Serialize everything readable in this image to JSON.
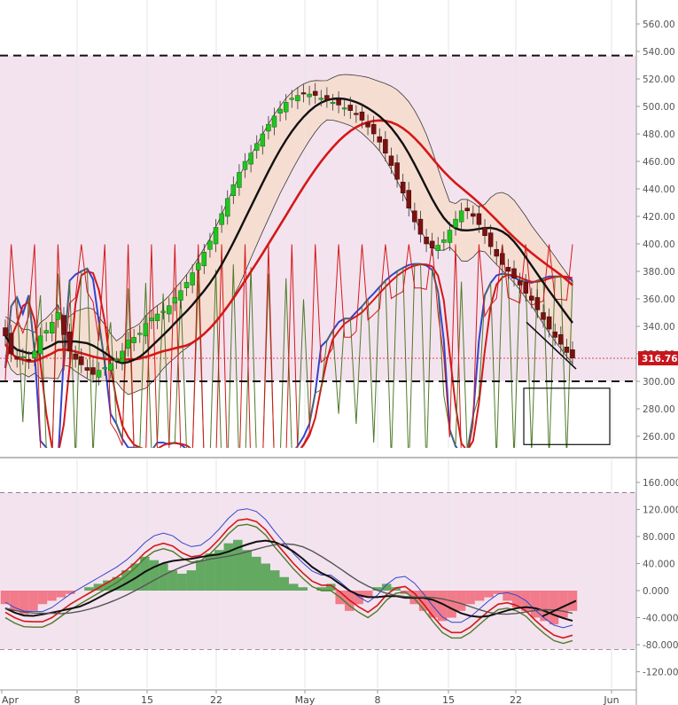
{
  "colors": {
    "band_fill": "#f6dccd",
    "pink_zone": "#f3e3ef",
    "green_candle": "#22c322",
    "red_candle": "#7a1212",
    "price_label_bg": "#c8161d",
    "blue_line": "#3344cc",
    "red_line": "#d41818",
    "olive_line": "#4f7a28",
    "black_line": "#111111",
    "hist_pos": "#3f9a3f",
    "hist_neg": "#f06070"
  },
  "top_panel": {
    "y_axis_ticks": [
      "560.00",
      "540.00",
      "520.00",
      "500.00",
      "480.00",
      "460.00",
      "440.00",
      "420.00",
      "400.00",
      "380.00",
      "360.00",
      "340.00",
      "320.00",
      "300.00",
      "280.00",
      "260.00"
    ],
    "last_price_label": "316.76"
  },
  "bottom_panel": {
    "y_axis_ticks": [
      "160.000",
      "120.000",
      "80.000",
      "40.000",
      "0.000",
      "-40.000",
      "-80.000",
      "-120.000"
    ]
  },
  "x_axis": {
    "labels": [
      "Apr",
      "8",
      "15",
      "22",
      "May",
      "8",
      "15",
      "22",
      "Jun"
    ]
  },
  "chart_data": [
    {
      "type": "candlestick",
      "y_axis_ticks": [
        560,
        540,
        520,
        500,
        480,
        460,
        440,
        420,
        400,
        380,
        360,
        340,
        320,
        300,
        280,
        260
      ],
      "ylim": [
        251,
        571
      ],
      "x_labels": [
        "Apr",
        "8",
        "15",
        "22",
        "May",
        "8",
        "15",
        "22",
        "Jun"
      ],
      "last_price": 316.76,
      "horizontal_levels": [
        537,
        300
      ],
      "series": [
        {
          "name": "close",
          "values": [
            333,
            320,
            316,
            318,
            315,
            322,
            333,
            337,
            343,
            350,
            334,
            322,
            316,
            312,
            308,
            305,
            308,
            310,
            313,
            316,
            322,
            330,
            332,
            335,
            342,
            346,
            349,
            351,
            355,
            361,
            366,
            372,
            379,
            386,
            394,
            402,
            412,
            422,
            433,
            443,
            452,
            460,
            466,
            473,
            480,
            487,
            493,
            498,
            503,
            506,
            508,
            509,
            509,
            508,
            506,
            505,
            503,
            501,
            499,
            497,
            494,
            490,
            485,
            480,
            474,
            466,
            457,
            447,
            437,
            426,
            416,
            407,
            400,
            397,
            399,
            403,
            410,
            418,
            424,
            424,
            420,
            414,
            406,
            398,
            391,
            385,
            380,
            375,
            370,
            364,
            359,
            352,
            345,
            338,
            332,
            327,
            321,
            317
          ]
        }
      ]
    },
    {
      "type": "line",
      "y_axis_ticks": [
        160,
        120,
        80,
        40,
        0,
        -40,
        -80,
        -120
      ],
      "ylim": [
        -130,
        180
      ],
      "x_labels": [
        "Apr",
        "8",
        "15",
        "22",
        "May",
        "8",
        "15",
        "22",
        "Jun"
      ],
      "horizontal_levels": [
        145,
        -87
      ],
      "series": [
        {
          "name": "histogram",
          "values": [
            -20,
            -30,
            -35,
            -30,
            -20,
            -15,
            -10,
            -5,
            0,
            5,
            10,
            15,
            20,
            30,
            40,
            50,
            45,
            40,
            30,
            25,
            30,
            45,
            55,
            60,
            70,
            75,
            60,
            50,
            40,
            30,
            20,
            10,
            5,
            0,
            5,
            10,
            -20,
            -30,
            -20,
            -10,
            5,
            10,
            5,
            -5,
            -20,
            -30,
            -40,
            -45,
            -40,
            -30,
            -20,
            -15,
            -10,
            -5,
            -15,
            -25,
            -30,
            -40,
            -45,
            -50,
            -40,
            -30
          ]
        }
      ]
    }
  ]
}
